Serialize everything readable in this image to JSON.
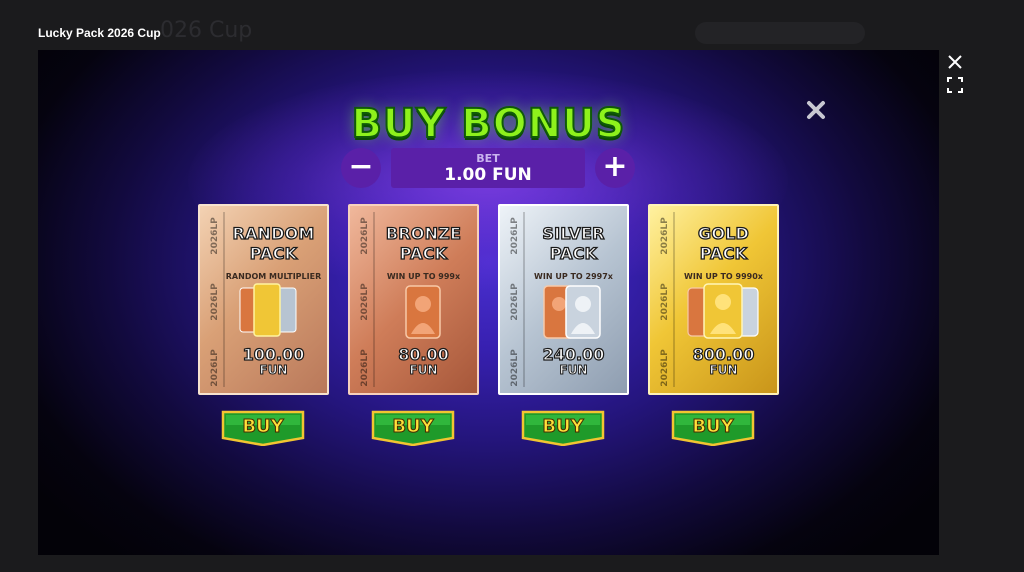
{
  "window": {
    "title": "Lucky Pack 2026 Cup",
    "bg_title_fragment": "026 Cup"
  },
  "game": {
    "heading": "BUY BONUS",
    "bet": {
      "label": "BET",
      "value": "1.00 FUN",
      "decrease_symbol": "−",
      "increase_symbol": "+"
    },
    "packs": [
      {
        "title_line1": "RANDOM",
        "title_line2": "PACK",
        "subtitle": "RANDOM MULTIPLIER",
        "price": "100.00",
        "currency": "FUN",
        "spine": "2026LP",
        "buy_label": "BUY",
        "colors": [
          "#f0c636",
          "#d9a076",
          "#b7c4d2"
        ]
      },
      {
        "title_line1": "BRONZE",
        "title_line2": "PACK",
        "subtitle": "WIN UP TO 999x",
        "price": "80.00",
        "currency": "FUN",
        "spine": "2026LP",
        "buy_label": "BUY",
        "colors": [
          "#d9763f"
        ]
      },
      {
        "title_line1": "SILVER",
        "title_line2": "PACK",
        "subtitle": "WIN UP TO 2997x",
        "price": "240.00",
        "currency": "FUN",
        "spine": "2026LP",
        "buy_label": "BUY",
        "colors": [
          "#d9763f",
          "#c9d3de"
        ]
      },
      {
        "title_line1": "GOLD",
        "title_line2": "PACK",
        "subtitle": "WIN UP TO 9990x",
        "price": "800.00",
        "currency": "FUN",
        "spine": "2026LP",
        "buy_label": "BUY",
        "colors": [
          "#d9763f",
          "#f0c636",
          "#c9d3de"
        ]
      }
    ]
  },
  "icons": {
    "close": "close-icon",
    "fullscreen": "fullscreen-icon",
    "popup_close": "close-x-icon"
  },
  "palette": {
    "heading_green": "#8ef21c",
    "bet_purple": "#5a20a8",
    "buy_green": "#1f9a2a",
    "buy_gold": "#f2c531"
  }
}
